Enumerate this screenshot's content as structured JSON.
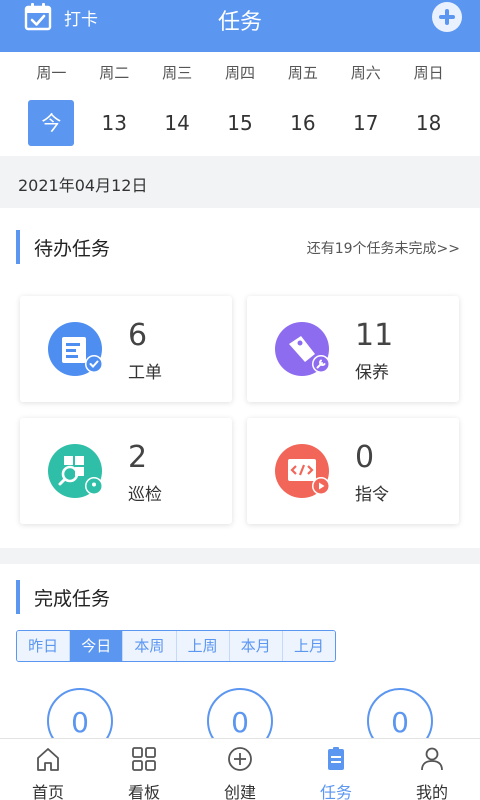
{
  "header": {
    "checkin_label": "打卡",
    "title": "任务"
  },
  "week": {
    "days": [
      "周一",
      "周二",
      "周三",
      "周四",
      "周五",
      "周六",
      "周日"
    ],
    "dates": [
      "今",
      "13",
      "14",
      "15",
      "16",
      "17",
      "18"
    ],
    "selected_index": 0
  },
  "date_bar": {
    "date": "2021年04月12日"
  },
  "todo": {
    "title": "待办任务",
    "more_link": "还有19个任务未完成>>",
    "cards": [
      {
        "count": "6",
        "label": "工单",
        "icon": "work-order-icon",
        "color": "#4f8ef1"
      },
      {
        "count": "11",
        "label": "保养",
        "icon": "maintenance-icon",
        "color": "#8e6cf0"
      },
      {
        "count": "2",
        "label": "巡检",
        "icon": "inspection-icon",
        "color": "#2fbfa8"
      },
      {
        "count": "0",
        "label": "指令",
        "icon": "instruction-icon",
        "color": "#f2665a"
      }
    ]
  },
  "done": {
    "title": "完成任务",
    "filters": [
      "昨日",
      "今日",
      "本周",
      "上周",
      "本月",
      "上月"
    ],
    "active_filter": "今日",
    "counts": [
      "0",
      "0",
      "0"
    ]
  },
  "tabbar": {
    "items": [
      {
        "label": "首页",
        "icon": "home-icon"
      },
      {
        "label": "看板",
        "icon": "dashboard-icon"
      },
      {
        "label": "创建",
        "icon": "create-icon"
      },
      {
        "label": "任务",
        "icon": "task-icon"
      },
      {
        "label": "我的",
        "icon": "profile-icon"
      }
    ],
    "active": "任务"
  },
  "colors": {
    "accent": "#5b96f1",
    "background": "#f2f3f5"
  }
}
